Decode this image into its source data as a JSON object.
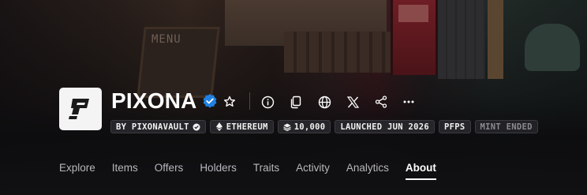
{
  "collection": {
    "name": "PIXONA",
    "verified_icon": "verified-badge-icon",
    "logo_icon": "pixona-p-logo"
  },
  "actions": [
    {
      "name": "favorite",
      "icon": "star-icon"
    },
    {
      "name": "info",
      "icon": "info-icon"
    },
    {
      "name": "copy",
      "icon": "copy-icon"
    },
    {
      "name": "website",
      "icon": "globe-icon"
    },
    {
      "name": "x",
      "icon": "x-logo-icon"
    },
    {
      "name": "share",
      "icon": "share-icon"
    },
    {
      "name": "more",
      "icon": "more-horizontal-icon"
    }
  ],
  "tags": {
    "creator": "BY PIXONAVAULT",
    "chain": "ETHEREUM",
    "supply": "10,000",
    "launched": "LAUNCHED JUN 2026",
    "category": "PFPS",
    "mint_status": "MINT ENDED"
  },
  "nav": {
    "tabs": [
      "Explore",
      "Items",
      "Offers",
      "Holders",
      "Traits",
      "Activity",
      "Analytics",
      "About"
    ],
    "active": "About"
  },
  "banner": {
    "sign_text": "MENU"
  },
  "colors": {
    "background": "#0e0e10",
    "verified": "#2081e2",
    "tag_bg": "#26262a",
    "active_tab": "#ffffff",
    "inactive_tab": "#b7b7bc"
  }
}
